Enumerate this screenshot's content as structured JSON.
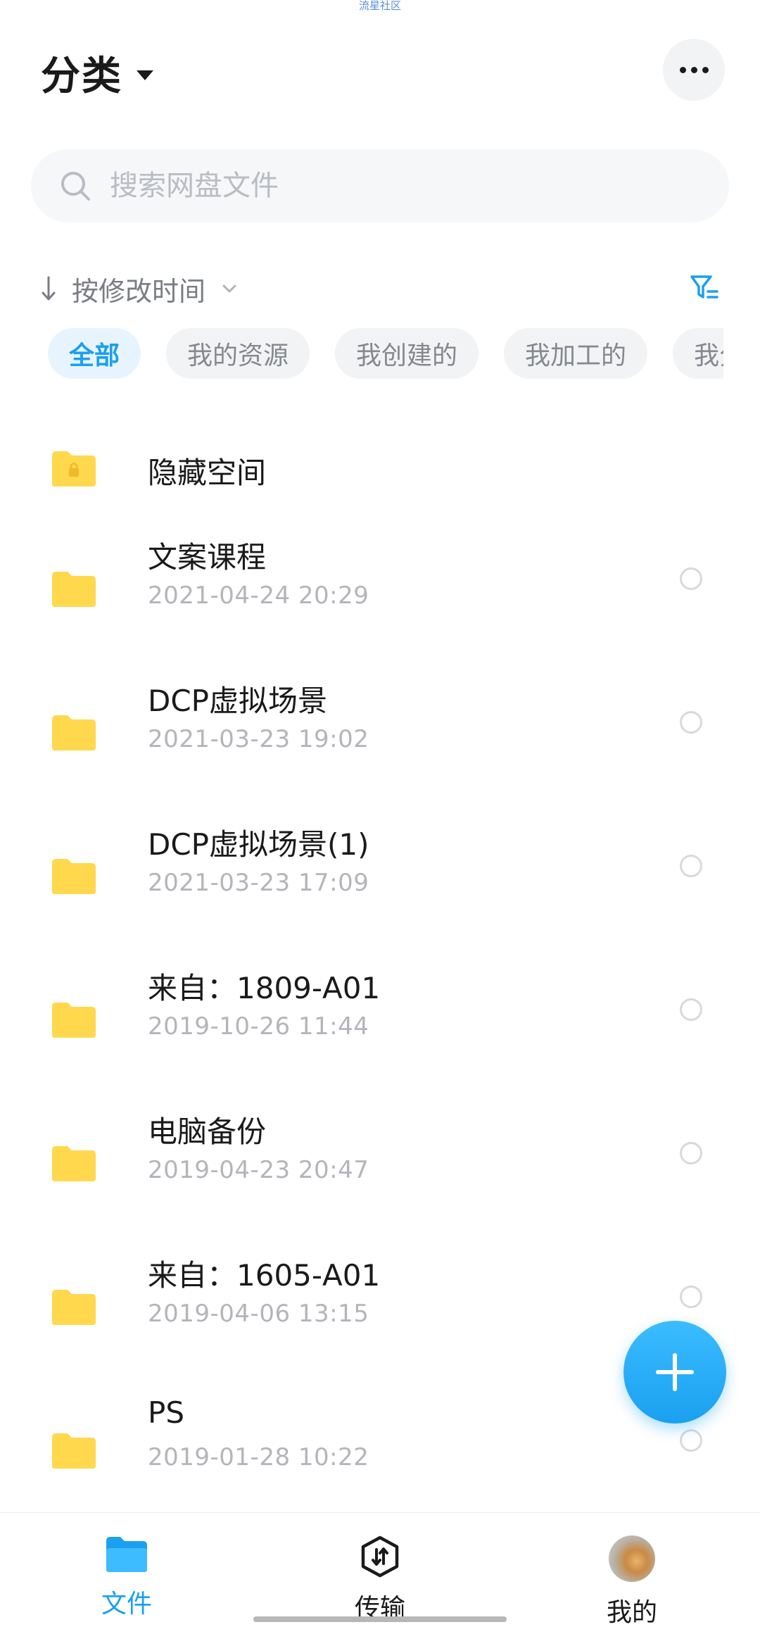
{
  "watermark": "流星社区",
  "header": {
    "title": "分类"
  },
  "search": {
    "placeholder": "搜索网盘文件"
  },
  "sort": {
    "label": "按修改时间"
  },
  "chips": [
    "全部",
    "我的资源",
    "我创建的",
    "我加工的",
    "我分享的"
  ],
  "files": [
    {
      "name": "隐藏空间",
      "date": ""
    },
    {
      "name": "文案课程",
      "date": "2021-04-24  20:29"
    },
    {
      "name": "DCP虚拟场景",
      "date": "2021-03-23  19:02"
    },
    {
      "name": "DCP虚拟场景(1)",
      "date": "2021-03-23  17:09"
    },
    {
      "name": "来自：1809-A01",
      "date": "2019-10-26  11:44"
    },
    {
      "name": "电脑备份",
      "date": "2019-04-23  20:47"
    },
    {
      "name": "来自：1605-A01",
      "date": "2019-04-06  13:15"
    },
    {
      "name": "PS",
      "date": "2019-01-28  10:22"
    }
  ],
  "tabs": {
    "files": "文件",
    "transfer": "传输",
    "mine": "我的"
  },
  "colors": {
    "accent": "#1aa0f0",
    "folder": "#ffd84d",
    "text_secondary": "#b3b5ba"
  }
}
